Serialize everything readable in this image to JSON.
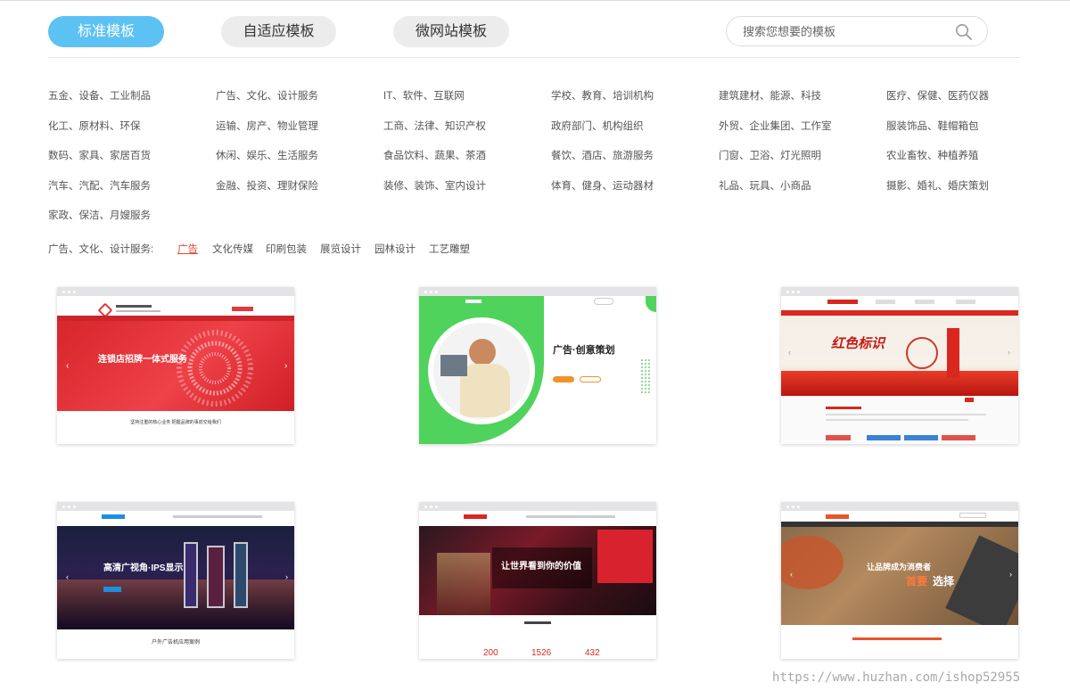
{
  "tabs": [
    {
      "label": "标准模板",
      "active": true
    },
    {
      "label": "自适应模板",
      "active": false
    },
    {
      "label": "微网站模板",
      "active": false
    }
  ],
  "search": {
    "placeholder": "搜索您想要的模板"
  },
  "categories": [
    "五金、设备、工业制品",
    "广告、文化、设计服务",
    "IT、软件、互联网",
    "学校、教育、培训机构",
    "建筑建材、能源、科技",
    "医疗、保健、医药仪器",
    "化工、原材料、环保",
    "运输、房产、物业管理",
    "工商、法律、知识产权",
    "政府部门、机构组织",
    "外贸、企业集团、工作室",
    "服装饰品、鞋帽箱包",
    "数码、家具、家居百货",
    "休闲、娱乐、生活服务",
    "食品饮料、蔬果、茶酒",
    "餐饮、酒店、旅游服务",
    "门窗、卫浴、灯光照明",
    "农业畜牧、种植养殖",
    "汽车、汽配、汽车服务",
    "金融、投资、理财保险",
    "装修、装饰、室内设计",
    "体育、健身、运动器材",
    "礼品、玩具、小商品",
    "摄影、婚礼、婚庆策划",
    "家政、保洁、月嫂服务"
  ],
  "subcategory": {
    "label": "广告、文化、设计服务:",
    "tags": [
      {
        "label": "广告",
        "active": true
      },
      {
        "label": "文化传媒",
        "active": false
      },
      {
        "label": "印刷包装",
        "active": false
      },
      {
        "label": "展览设计",
        "active": false
      },
      {
        "label": "园林设计",
        "active": false
      },
      {
        "label": "工艺雕塑",
        "active": false
      }
    ]
  },
  "templates": [
    {
      "banner_text": "连锁店招牌一体式服务",
      "caption": "坚持注重的核心业务 把握品牌的事前交给我们",
      "theme_color": "#e23a3a"
    },
    {
      "banner_text": "广告·创意策划",
      "theme_color": "#4fd35c"
    },
    {
      "banner_text": "红色标识",
      "theme_color": "#d9271f"
    },
    {
      "banner_text": "高清广视角·IPS显示",
      "caption": "户外广告机应用案例",
      "theme_color": "#1e8ede"
    },
    {
      "banner_text": "让世界看到你的价值",
      "stats": [
        "200",
        "1526",
        "432"
      ],
      "theme_color": "#d9271f"
    },
    {
      "banner_text_a": "让品牌成为消费者",
      "banner_text_b": "首要",
      "banner_text_c": "选择",
      "theme_color": "#e8552a"
    }
  ],
  "watermark": "https://www.huzhan.com/ishop52955"
}
